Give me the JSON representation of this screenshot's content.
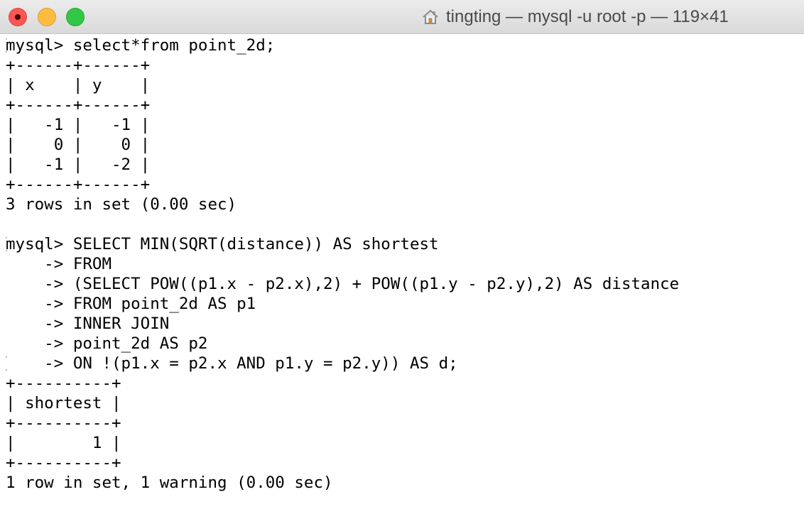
{
  "window": {
    "title": "tingting — mysql -u root -p — 119×41",
    "icons": {
      "close": "close-button",
      "minimize": "minimize-button",
      "maximize": "maximize-button",
      "home": "home-icon"
    },
    "colors": {
      "close": "#fc5753",
      "minimize": "#fdbc40",
      "maximize": "#33c748"
    }
  },
  "terminal": {
    "lines": [
      "mysql> select*from point_2d;",
      "+------+------+",
      "| x    | y    |",
      "+------+------+",
      "|   -1 |   -1 |",
      "|    0 |    0 |",
      "|   -1 |   -2 |",
      "+------+------+",
      "3 rows in set (0.00 sec)",
      "",
      "mysql> SELECT MIN(SQRT(distance)) AS shortest",
      "    -> FROM",
      "    -> (SELECT POW((p1.x - p2.x),2) + POW((p1.y - p2.y),2) AS distance",
      "    -> FROM point_2d AS p1",
      "    -> INNER JOIN",
      "    -> point_2d AS p2",
      "    -> ON !(p1.x = p2.x AND p1.y = p2.y)) AS d;",
      "+----------+",
      "| shortest |",
      "+----------+",
      "|        1 |",
      "+----------+",
      "1 row in set, 1 warning (0.00 sec)"
    ],
    "marked_lines": [
      0,
      10,
      16
    ],
    "marker": "["
  }
}
